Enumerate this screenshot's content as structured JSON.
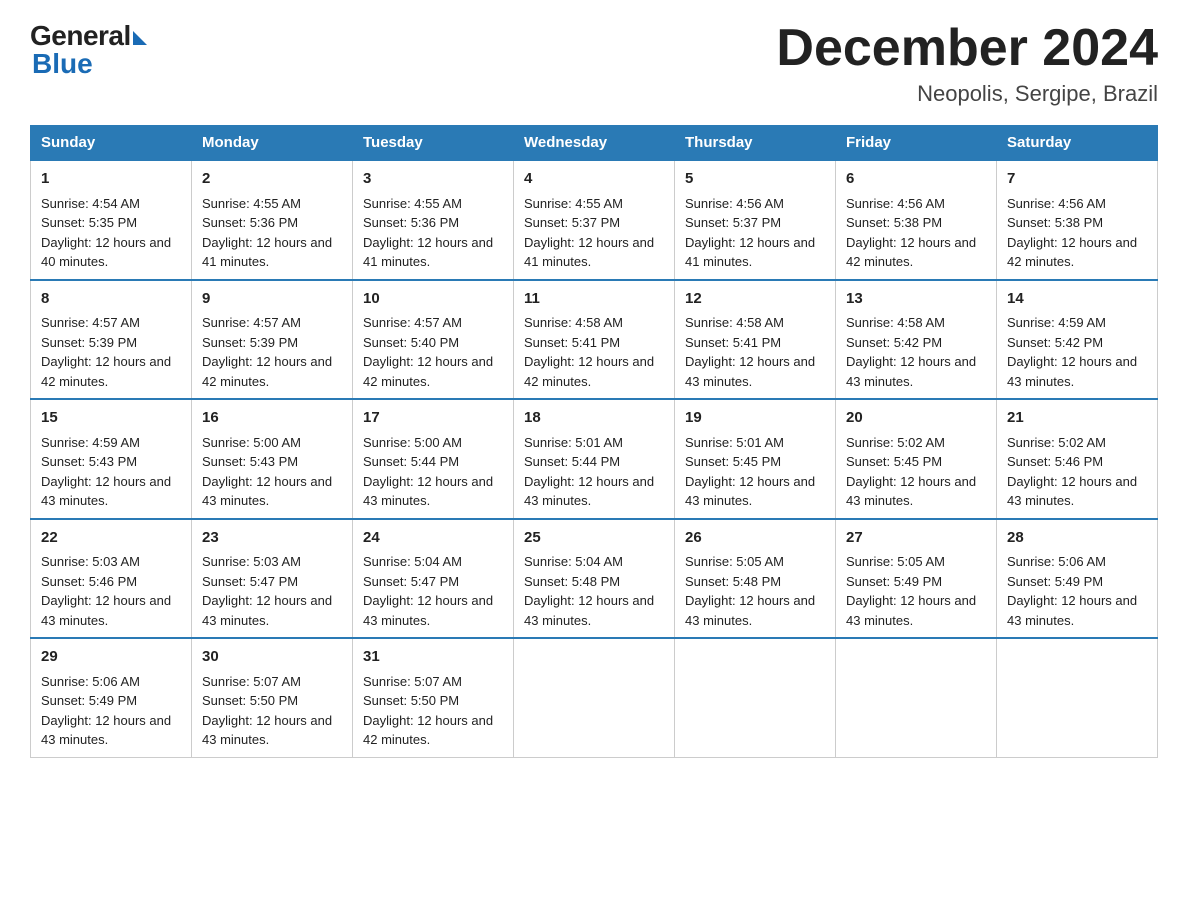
{
  "header": {
    "logo_general": "General",
    "logo_blue": "Blue",
    "month_title": "December 2024",
    "location": "Neopolis, Sergipe, Brazil"
  },
  "days_of_week": [
    "Sunday",
    "Monday",
    "Tuesday",
    "Wednesday",
    "Thursday",
    "Friday",
    "Saturday"
  ],
  "weeks": [
    [
      {
        "day": "1",
        "sunrise": "4:54 AM",
        "sunset": "5:35 PM",
        "daylight": "12 hours and 40 minutes."
      },
      {
        "day": "2",
        "sunrise": "4:55 AM",
        "sunset": "5:36 PM",
        "daylight": "12 hours and 41 minutes."
      },
      {
        "day": "3",
        "sunrise": "4:55 AM",
        "sunset": "5:36 PM",
        "daylight": "12 hours and 41 minutes."
      },
      {
        "day": "4",
        "sunrise": "4:55 AM",
        "sunset": "5:37 PM",
        "daylight": "12 hours and 41 minutes."
      },
      {
        "day": "5",
        "sunrise": "4:56 AM",
        "sunset": "5:37 PM",
        "daylight": "12 hours and 41 minutes."
      },
      {
        "day": "6",
        "sunrise": "4:56 AM",
        "sunset": "5:38 PM",
        "daylight": "12 hours and 42 minutes."
      },
      {
        "day": "7",
        "sunrise": "4:56 AM",
        "sunset": "5:38 PM",
        "daylight": "12 hours and 42 minutes."
      }
    ],
    [
      {
        "day": "8",
        "sunrise": "4:57 AM",
        "sunset": "5:39 PM",
        "daylight": "12 hours and 42 minutes."
      },
      {
        "day": "9",
        "sunrise": "4:57 AM",
        "sunset": "5:39 PM",
        "daylight": "12 hours and 42 minutes."
      },
      {
        "day": "10",
        "sunrise": "4:57 AM",
        "sunset": "5:40 PM",
        "daylight": "12 hours and 42 minutes."
      },
      {
        "day": "11",
        "sunrise": "4:58 AM",
        "sunset": "5:41 PM",
        "daylight": "12 hours and 42 minutes."
      },
      {
        "day": "12",
        "sunrise": "4:58 AM",
        "sunset": "5:41 PM",
        "daylight": "12 hours and 43 minutes."
      },
      {
        "day": "13",
        "sunrise": "4:58 AM",
        "sunset": "5:42 PM",
        "daylight": "12 hours and 43 minutes."
      },
      {
        "day": "14",
        "sunrise": "4:59 AM",
        "sunset": "5:42 PM",
        "daylight": "12 hours and 43 minutes."
      }
    ],
    [
      {
        "day": "15",
        "sunrise": "4:59 AM",
        "sunset": "5:43 PM",
        "daylight": "12 hours and 43 minutes."
      },
      {
        "day": "16",
        "sunrise": "5:00 AM",
        "sunset": "5:43 PM",
        "daylight": "12 hours and 43 minutes."
      },
      {
        "day": "17",
        "sunrise": "5:00 AM",
        "sunset": "5:44 PM",
        "daylight": "12 hours and 43 minutes."
      },
      {
        "day": "18",
        "sunrise": "5:01 AM",
        "sunset": "5:44 PM",
        "daylight": "12 hours and 43 minutes."
      },
      {
        "day": "19",
        "sunrise": "5:01 AM",
        "sunset": "5:45 PM",
        "daylight": "12 hours and 43 minutes."
      },
      {
        "day": "20",
        "sunrise": "5:02 AM",
        "sunset": "5:45 PM",
        "daylight": "12 hours and 43 minutes."
      },
      {
        "day": "21",
        "sunrise": "5:02 AM",
        "sunset": "5:46 PM",
        "daylight": "12 hours and 43 minutes."
      }
    ],
    [
      {
        "day": "22",
        "sunrise": "5:03 AM",
        "sunset": "5:46 PM",
        "daylight": "12 hours and 43 minutes."
      },
      {
        "day": "23",
        "sunrise": "5:03 AM",
        "sunset": "5:47 PM",
        "daylight": "12 hours and 43 minutes."
      },
      {
        "day": "24",
        "sunrise": "5:04 AM",
        "sunset": "5:47 PM",
        "daylight": "12 hours and 43 minutes."
      },
      {
        "day": "25",
        "sunrise": "5:04 AM",
        "sunset": "5:48 PM",
        "daylight": "12 hours and 43 minutes."
      },
      {
        "day": "26",
        "sunrise": "5:05 AM",
        "sunset": "5:48 PM",
        "daylight": "12 hours and 43 minutes."
      },
      {
        "day": "27",
        "sunrise": "5:05 AM",
        "sunset": "5:49 PM",
        "daylight": "12 hours and 43 minutes."
      },
      {
        "day": "28",
        "sunrise": "5:06 AM",
        "sunset": "5:49 PM",
        "daylight": "12 hours and 43 minutes."
      }
    ],
    [
      {
        "day": "29",
        "sunrise": "5:06 AM",
        "sunset": "5:49 PM",
        "daylight": "12 hours and 43 minutes."
      },
      {
        "day": "30",
        "sunrise": "5:07 AM",
        "sunset": "5:50 PM",
        "daylight": "12 hours and 43 minutes."
      },
      {
        "day": "31",
        "sunrise": "5:07 AM",
        "sunset": "5:50 PM",
        "daylight": "12 hours and 42 minutes."
      },
      null,
      null,
      null,
      null
    ]
  ],
  "labels": {
    "sunrise": "Sunrise:",
    "sunset": "Sunset:",
    "daylight": "Daylight:"
  }
}
